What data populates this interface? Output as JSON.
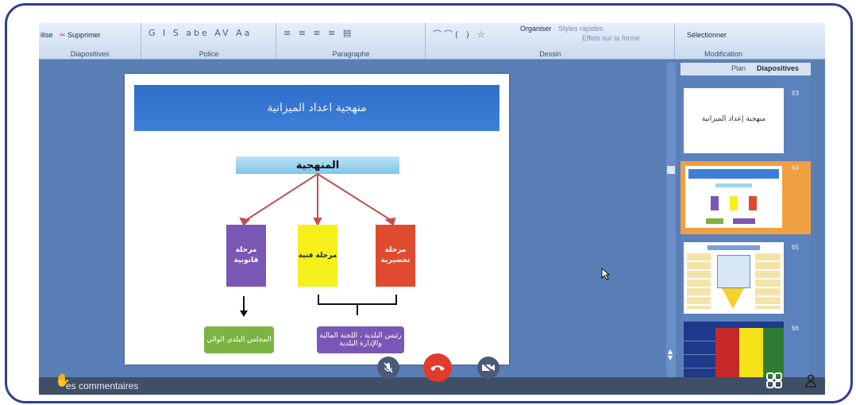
{
  "ribbon": {
    "dispositives": {
      "item": "Supprimer",
      "group": "Diapositives",
      "prefix": "ilise"
    },
    "police": {
      "group": "Police",
      "tools": "G I S abe AV Aa"
    },
    "paragraphe": {
      "group": "Paragraphe",
      "tools": "≡ ≡ ≡ ≡ ▤"
    },
    "dessin": {
      "group": "Dessin",
      "organiser": "Organiser",
      "styles": "Styles rapides",
      "effets": "Effets sur la forme",
      "shapes": "⌒⌒( ) ☆"
    },
    "modification": {
      "group": "Modification",
      "select": "Sélectionner"
    }
  },
  "slide": {
    "title": "منهجية اعداد الميزانية",
    "method": "المنهجية",
    "boxes": [
      {
        "label": "مرحلة تحضيرية",
        "color": "#e04a2f"
      },
      {
        "label": "مرحلة فنية",
        "color": "#f5ef1c"
      },
      {
        "label": "مرحلة قانونية",
        "color": "#7b57b5"
      }
    ],
    "green_box": "المجلس البلدي الوالي",
    "purple_box": "رئيس البلدية ، اللجنة المالية والإدارة البلدية"
  },
  "pane": {
    "tab_plan": "Plan",
    "tab_dispositives": "Diapositives",
    "thumbs": [
      {
        "num": "63",
        "text": "منهجية إعداد الميزانية"
      },
      {
        "num": "64",
        "text": ""
      },
      {
        "num": "65",
        "text": ""
      },
      {
        "num": "66",
        "text": ""
      }
    ]
  },
  "status": {
    "comments": "es commentaires"
  },
  "colors": {
    "accent": "#2e3f8f",
    "hangup": "#e23b2c",
    "ctrl": "#4a5a78"
  },
  "icons": [
    "mic-off-icon",
    "hangup-icon",
    "camera-off-icon",
    "grid-icon",
    "participants-icon",
    "hand-icon"
  ]
}
